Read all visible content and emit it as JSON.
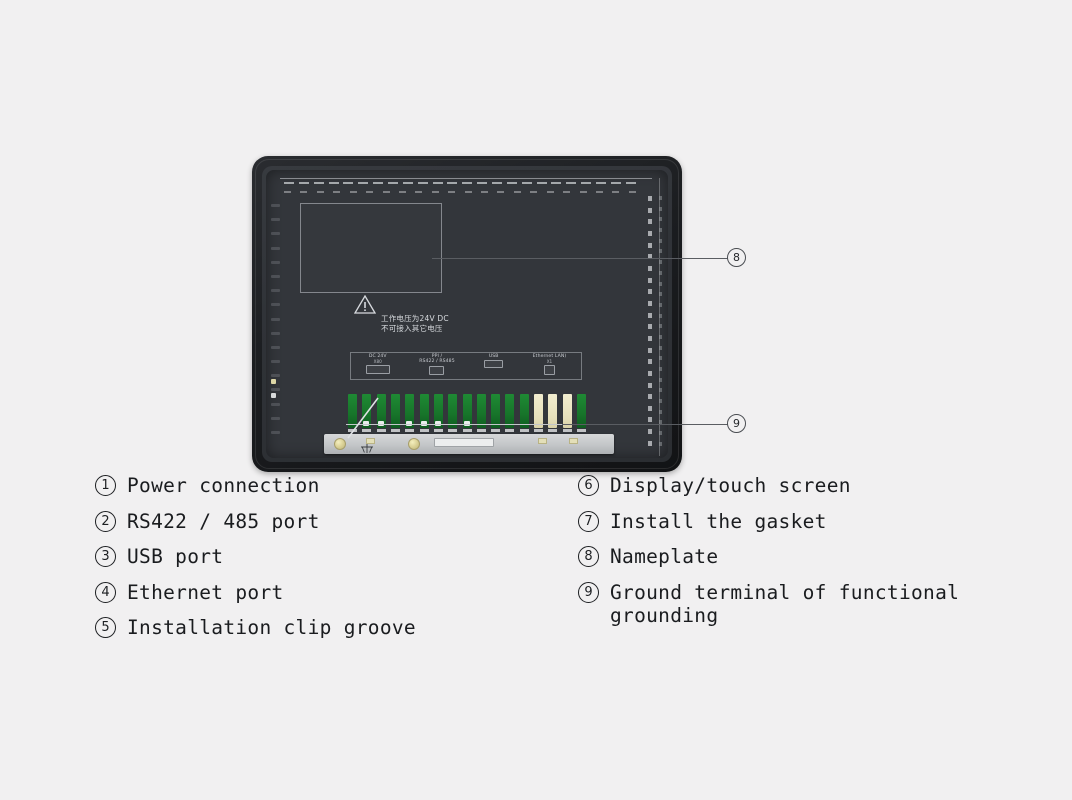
{
  "background_color": "#f1f0f1",
  "device": {
    "name": "hmi-panel-rear-view",
    "body_color": "#33363b",
    "bezel_color": "#1b1d20",
    "nameplate": {
      "label": "",
      "description": "blank nameplate rectangle"
    },
    "warning": {
      "icon": "warning-triangle-icon",
      "line1": "工作电压为24V DC",
      "line2": "不可接入其它电压"
    },
    "ports": [
      {
        "name": "DC 24V",
        "code": "X80",
        "socket": "power-terminal"
      },
      {
        "name": "PPI /",
        "name2": "RS422 / RS485",
        "code": "X2",
        "socket": "serial-port"
      },
      {
        "name": "USB",
        "code": "",
        "socket": "usb-port"
      },
      {
        "name": "Ethernet LAN)",
        "code": "X1",
        "socket": "ethernet-port"
      }
    ],
    "connector_fins": {
      "count": 17,
      "green_color": "#17742a",
      "cream_color": "#e6e0bb",
      "cream_indices": [
        13,
        14,
        15
      ]
    },
    "ground_bracket": {
      "symbol": "earth-ground-icon",
      "color": "#c3c6c8"
    }
  },
  "callouts": [
    {
      "id": "8",
      "label": "8",
      "target": "nameplate"
    },
    {
      "id": "9",
      "label": "9",
      "target": "ground-terminal"
    }
  ],
  "legend": {
    "left_column": [
      {
        "num": "1",
        "text": "Power connection"
      },
      {
        "num": "2",
        "text": "RS422 / 485 port"
      },
      {
        "num": "3",
        "text": "USB port"
      },
      {
        "num": "4",
        "text": "Ethernet port"
      },
      {
        "num": "5",
        "text": "Installation clip groove"
      }
    ],
    "right_column": [
      {
        "num": "6",
        "text": "Display/touch screen"
      },
      {
        "num": "7",
        "text": "Install the gasket"
      },
      {
        "num": "8",
        "text": "Nameplate"
      },
      {
        "num": "9",
        "text": "Ground terminal of functional\ngrounding"
      }
    ]
  }
}
